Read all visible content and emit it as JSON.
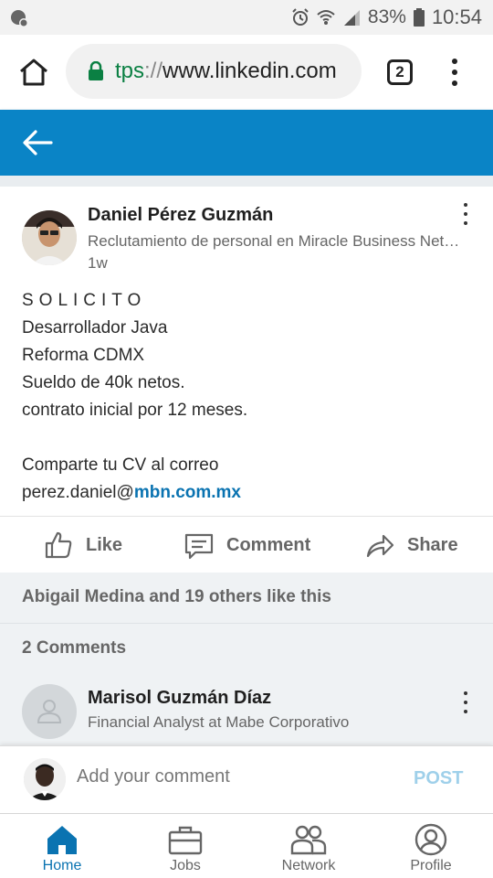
{
  "status_bar": {
    "battery": "83%",
    "time": "10:54"
  },
  "browser": {
    "url_scheme": "tps",
    "url_separator": "://",
    "url_host": "www.linkedin.com",
    "tab_count": "2"
  },
  "post": {
    "author_name": "Daniel Pérez Guzmán",
    "author_headline": "Reclutamiento de personal en Miracle Business Network",
    "time_ago": "1w",
    "body_lines": [
      "SOLICITO",
      "Desarrollador Java",
      "Reforma CDMX",
      "Sueldo de 40k netos.",
      "contrato inicial por 12 meses.",
      "",
      "Comparte tu CV  al correo"
    ],
    "email_prefix": "perez.daniel@",
    "email_link": "mbn.com.mx"
  },
  "actions": {
    "like": "Like",
    "comment": "Comment",
    "share": "Share"
  },
  "social": {
    "likes_summary": "Abigail Medina and 19 others like this",
    "comments_count": "2 Comments"
  },
  "comment": {
    "name": "Marisol Guzmán Díaz",
    "headline": "Financial Analyst at Mabe Corporativo"
  },
  "composer": {
    "placeholder": "Add your comment",
    "post_label": "POST"
  },
  "nav": {
    "home": "Home",
    "jobs": "Jobs",
    "network": "Network",
    "profile": "Profile"
  },
  "colors": {
    "brand": "#0a84c6",
    "link": "#0a73b1",
    "lock": "#0b8043",
    "post_button_disabled": "#9fd0ea"
  }
}
